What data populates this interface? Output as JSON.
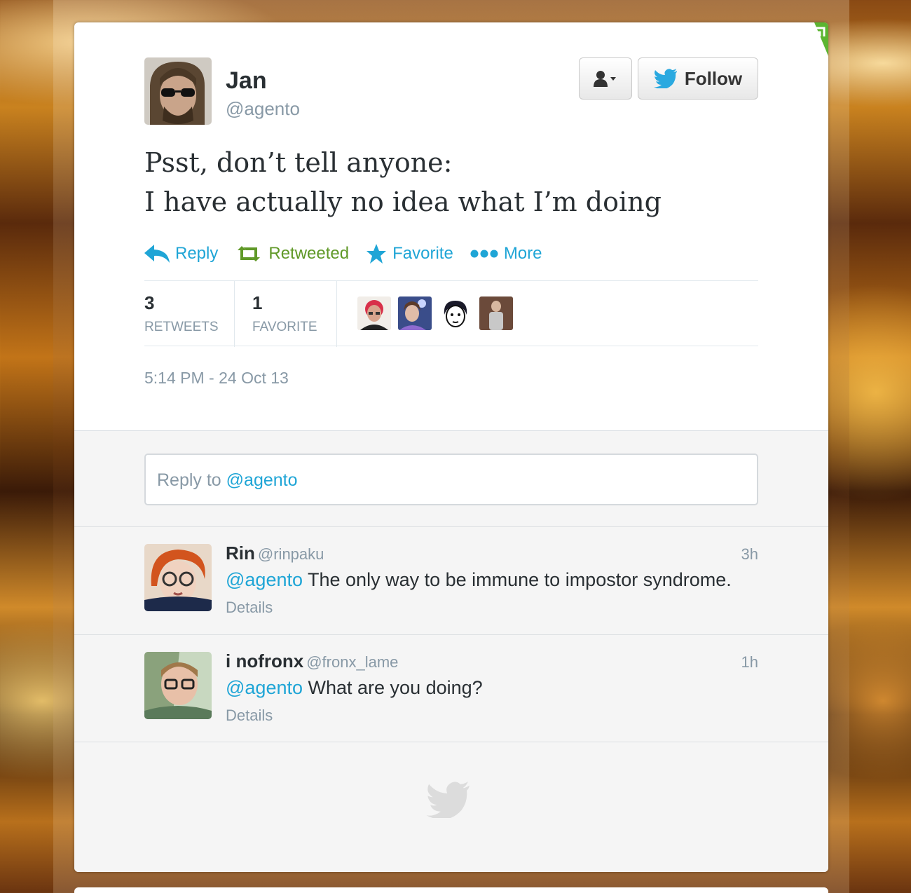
{
  "author": {
    "name": "Jan",
    "handle": "@agento"
  },
  "buttons": {
    "follow_label": "Follow",
    "user_actions_icon": "person-dropdown-icon"
  },
  "tweet": {
    "line1": "Psst, don’t tell anyone:",
    "line2": "I have actually no idea what I’m doing",
    "timestamp": "5:14 PM - 24 Oct 13"
  },
  "actions": {
    "reply": "Reply",
    "retweet": "Retweeted",
    "favorite": "Favorite",
    "more": "More"
  },
  "stats": {
    "retweets_count": "3",
    "retweets_label": "RETWEETS",
    "favorites_count": "1",
    "favorites_label": "FAVORITE"
  },
  "reply_box": {
    "prefix": "Reply to",
    "mention": "@agento"
  },
  "replies": [
    {
      "name": "Rin",
      "handle": "@rinpaku",
      "time": "3h",
      "mention": "@agento",
      "text": "The only way to be immune to impostor syndrome.",
      "details": "Details"
    },
    {
      "name": "i nofronx",
      "handle": "@fronx_lame",
      "time": "1h",
      "mention": "@agento",
      "text": "What are you doing?",
      "details": "Details"
    }
  ],
  "colors": {
    "link_blue": "#1fa5d6",
    "retweet_green": "#609928",
    "text_dark": "#292f33",
    "text_muted": "#8899a6"
  }
}
